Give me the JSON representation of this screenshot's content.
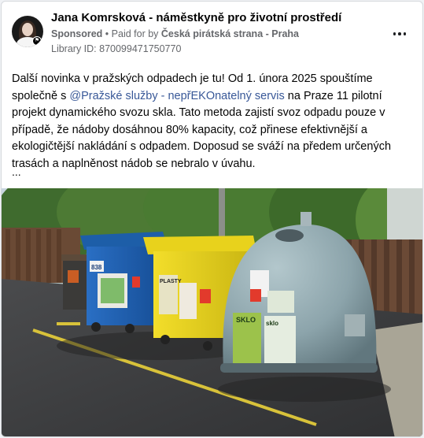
{
  "post": {
    "author": "Jana Komrsková - náměstkyně pro životní prostředí",
    "sponsored": "Sponsored",
    "paid_for_prefix": "Paid for by",
    "sponsor": "Česká pirátská strana - Praha",
    "separator": "•",
    "library_id": "Library ID: 870099471750770",
    "text_part1": "Další novinka v pražských odpadech je tu! Od 1. února 2025 spouštíme společně s ",
    "mention": "@Pražské služby - nepřEKOnatelný servis",
    "text_part2": " na Praze 11 pilotní projekt dynamického svozu skla. Tato metoda zajistí svoz odpadu pouze v případě, že nádoby dosáhnou 80% kapacity, což přinese efektivnější a ekologičtější nakládání s odpadem. Doposud se sváží na předem určených trasách a naplněnost nádob se nebralo v úvahu.",
    "see_more": "..."
  },
  "icons": {
    "avatar": "avatar-profile-photo",
    "more": "more-options-icon"
  },
  "image": {
    "labels": {
      "blue_bin_number": "838",
      "yellow_bin_text": "PLASTY",
      "glass_bin_text": "SKLO",
      "glass_bin_text2": "sklo"
    }
  },
  "colors": {
    "link": "#385898",
    "meta": "#65676b",
    "blue_bin": "#1f5fb0",
    "yellow_bin": "#e8d21c",
    "glass_bin": "#8fa8b0"
  }
}
